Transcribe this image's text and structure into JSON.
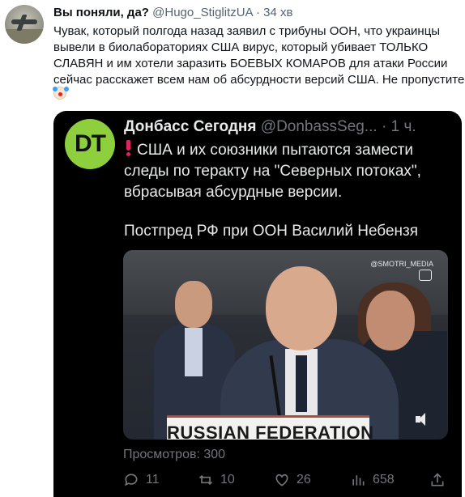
{
  "outer_tweet": {
    "name": "Вы поняли, да?",
    "handle": "@Hugo_StiglitzUA",
    "separator": "·",
    "time": "34 хв",
    "text_lines": [
      "Чувак, который полгода назад заявил с трибуны ООН, что украинцы",
      "вывели в биолабораториях США вирус, который убивает ТОЛЬКО",
      "СЛАВЯН и им хотели заразить БОЕВЫХ КОМАРОВ для атаки России",
      "сейчас расскажет всем нам об абсурдности версий США. Не пропустите"
    ],
    "emoji_icon": "clown-face-icon"
  },
  "inner_tweet": {
    "avatar_text": "DT",
    "name": "Донбасс Сегодня",
    "handle": "@DonbassSeg...",
    "separator": "·",
    "time": "1 ч.",
    "text_lines": [
      "США и их союзники пытаются замести",
      "следы по теракту на \"Северных потоках\",",
      "вбрасывая абсурдные версии."
    ],
    "source_line": "Постпред РФ при ООН Василий Небензя",
    "video": {
      "watermark": "@SMOTRI_MEDIA",
      "placard": "RUSSIAN FEDERATION",
      "mute_icon": "speaker-muted-icon"
    },
    "views": "Просмотров: 300",
    "actions": {
      "replies": "11",
      "retweets": "10",
      "likes": "26",
      "stats": "658"
    }
  },
  "colors": {
    "embed_background": "#000000",
    "inner_text": "#e7e9ea",
    "inner_muted": "#71767b",
    "dt_logo_green": "#8ecf3d",
    "exclaim_red": "#e0245e"
  }
}
